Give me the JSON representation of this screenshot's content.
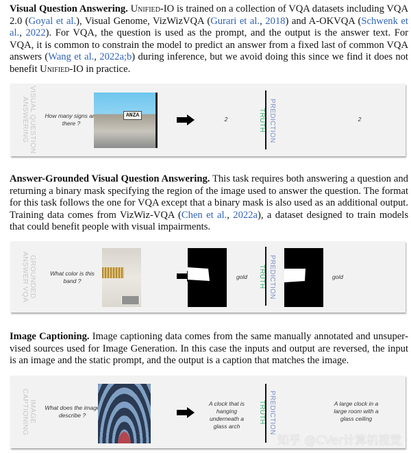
{
  "sections": [
    {
      "segments": [
        {
          "t": "Visual Question Answering.",
          "b": true
        },
        {
          "t": "  "
        },
        {
          "t": "Unified-IO",
          "sc": true
        },
        {
          "t": " is trained on a collection of VQA datasets in­cluding VQA 2.0 ("
        },
        {
          "t": "Goyal et al.",
          "c": true
        },
        {
          "t": "), Visual Genome, VizWizVQA ("
        },
        {
          "t": "Gurari et al.",
          "c": true
        },
        {
          "t": ", "
        },
        {
          "t": "2018",
          "c": true
        },
        {
          "t": ") and A-OKVQA ("
        },
        {
          "t": "Schwenk et al.",
          "c": true
        },
        {
          "t": ", "
        },
        {
          "t": "2022",
          "c": true
        },
        {
          "t": "). For VQA, the question is used as the prompt, and the output is the answer text. For VQA, it is common to constrain the model to predict an answer from a fixed last of common VQA answers ("
        },
        {
          "t": "Wang et al.",
          "c": true
        },
        {
          "t": ", "
        },
        {
          "t": "2022a;b",
          "c": true
        },
        {
          "t": ") during inference, but we avoid doing this since we find it does not benefit "
        },
        {
          "t": "Unified",
          "sc": true
        },
        {
          "t": "-IO in practice."
        }
      ]
    },
    {
      "segments": [
        {
          "t": "Answer-Grounded Visual Question Answering.",
          "b": true
        },
        {
          "t": " This task requires both answering a question and returning a binary mask specifying the region of the image used to answer the question. The format for this task follows the one for VQA except that a binary mask is also used as an additional output. Training data comes from VizWiz-VQA ("
        },
        {
          "t": "Chen et al.",
          "c": true
        },
        {
          "t": ", "
        },
        {
          "t": "2022a",
          "c": true
        },
        {
          "t": "), a dataset designed to train models that could benefit people with visual impairments."
        }
      ]
    },
    {
      "segments": [
        {
          "t": "Image Captioning.",
          "b": true
        },
        {
          "t": " Image captioning data comes from the same manually annotated and unsuper­vised sources used for Image Generation. In this case the inputs and output are reversed, the input is an image and the static prompt, and the output is a caption that matches the image."
        }
      ]
    }
  ],
  "panels": [
    {
      "label": "VISUAL QUESTION ANSWERING",
      "question": "How many signs are there ?",
      "truth_output": "2",
      "pred_output": "2",
      "sign_text": "ANZA"
    },
    {
      "label": "GROUNDED ANSWER VQA",
      "question": "What color is this band ?",
      "truth_output": "gold",
      "pred_output": "gold"
    },
    {
      "label": "IMAGE CAPTIONING",
      "question": "What does the image describe ?",
      "truth_output": "A clock that is hanging underneath a glass arch",
      "pred_output": "A large clock in a large room with a glass ceiling"
    }
  ],
  "truth_label": "TRUTH",
  "prediction_label": "PREDICTION",
  "watermark": "知乎 @CVer计算机视觉",
  "colors": {
    "citation": "#2f63b8",
    "truth": "#3fb27a",
    "prediction": "#7a90c8"
  }
}
